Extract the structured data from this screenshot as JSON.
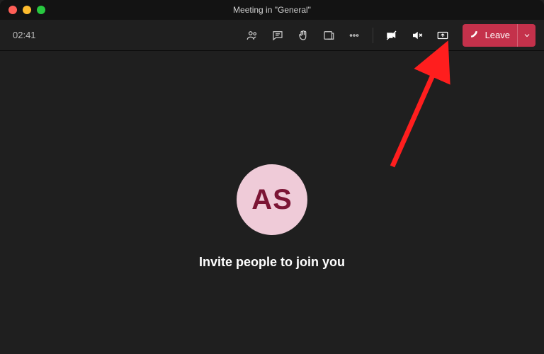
{
  "window": {
    "title": "Meeting in \"General\""
  },
  "toolbar": {
    "timer": "02:41",
    "leave_label": "Leave"
  },
  "main": {
    "avatar_initials": "AS",
    "invite_text": "Invite people to join you"
  }
}
